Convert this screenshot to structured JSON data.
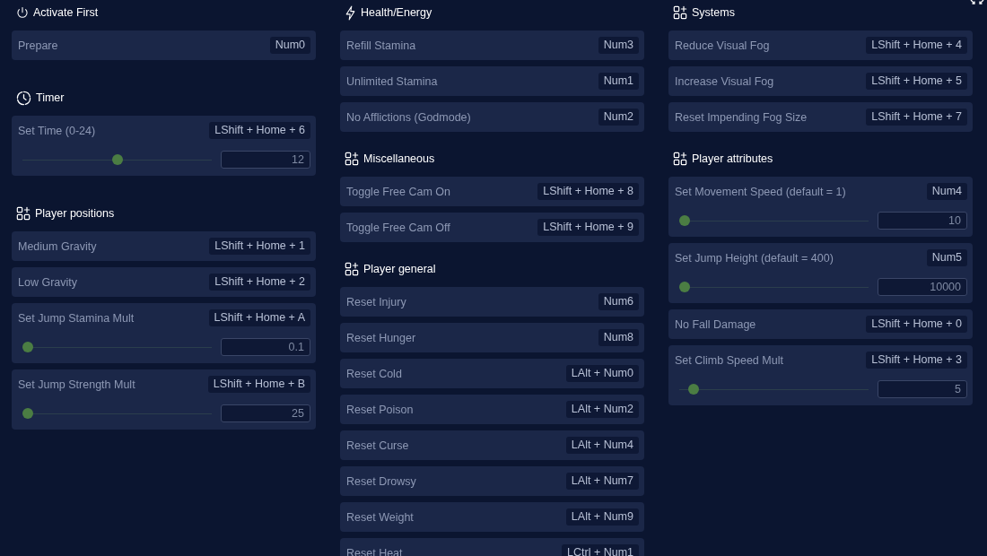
{
  "columns": [
    {
      "sections": [
        {
          "kind": "power",
          "title": "Activate First",
          "items": [
            {
              "kind": "button",
              "label": "Prepare",
              "hotkey": "Num0"
            }
          ]
        },
        {
          "kind": "timer",
          "title": "Timer",
          "items": [
            {
              "kind": "slider",
              "label": "Set Time (0-24)",
              "hotkey": "LShift + Home + 6",
              "level": 0.5,
              "value": "12"
            }
          ]
        },
        {
          "kind": "category",
          "title": "Player positions",
          "items": [
            {
              "kind": "button",
              "label": "Medium Gravity",
              "hotkey": "LShift + Home + 1"
            },
            {
              "kind": "button",
              "label": "Low Gravity",
              "hotkey": "LShift + Home + 2"
            },
            {
              "kind": "slider",
              "label": "Set Jump Stamina Mult",
              "hotkey": "LShift + Home + A",
              "level": 0,
              "value": "0.1"
            },
            {
              "kind": "slider",
              "label": "Set Jump Strength Mult",
              "hotkey": "LShift + Home + B",
              "level": 0,
              "value": "25"
            }
          ]
        }
      ]
    },
    {
      "sections": [
        {
          "kind": "energy",
          "title": "Health/Energy",
          "items": [
            {
              "kind": "button",
              "label": "Refill Stamina",
              "hotkey": "Num3"
            },
            {
              "kind": "button",
              "label": "Unlimited Stamina",
              "hotkey": "Num1"
            },
            {
              "kind": "button",
              "label": "No Afflictions (Godmode)",
              "hotkey": "Num2"
            }
          ]
        },
        {
          "kind": "category",
          "title": "Miscellaneous",
          "items": [
            {
              "kind": "button",
              "label": "Toggle Free Cam On",
              "hotkey": "LShift + Home + 8"
            },
            {
              "kind": "button",
              "label": "Toggle Free Cam Off",
              "hotkey": "LShift + Home + 9"
            }
          ]
        },
        {
          "kind": "category",
          "title": "Player general",
          "items": [
            {
              "kind": "button",
              "label": "Reset Injury",
              "hotkey": "Num6"
            },
            {
              "kind": "button",
              "label": "Reset Hunger",
              "hotkey": "Num8"
            },
            {
              "kind": "button",
              "label": "Reset Cold",
              "hotkey": "LAlt + Num0"
            },
            {
              "kind": "button",
              "label": "Reset Poison",
              "hotkey": "LAlt + Num2"
            },
            {
              "kind": "button",
              "label": "Reset Curse",
              "hotkey": "LAlt + Num4"
            },
            {
              "kind": "button",
              "label": "Reset Drowsy",
              "hotkey": "LAlt + Num7"
            },
            {
              "kind": "button",
              "label": "Reset Weight",
              "hotkey": "LAlt + Num9"
            },
            {
              "kind": "button",
              "label": "Reset Heat",
              "hotkey": "LCtrl + Num1"
            }
          ]
        }
      ]
    },
    {
      "sections": [
        {
          "kind": "category",
          "title": "Systems",
          "items": [
            {
              "kind": "button",
              "label": "Reduce Visual Fog",
              "hotkey": "LShift + Home + 4"
            },
            {
              "kind": "button",
              "label": "Increase Visual Fog",
              "hotkey": "LShift + Home + 5"
            },
            {
              "kind": "button",
              "label": "Reset Impending Fog Size",
              "hotkey": "LShift + Home + 7"
            }
          ]
        },
        {
          "kind": "category",
          "title": "Player attributes",
          "items": [
            {
              "kind": "slider",
              "label": "Set Movement Speed (default = 1)",
              "hotkey": "Num4",
              "level": 0,
              "value": "10"
            },
            {
              "kind": "slider",
              "label": "Set Jump Height (default = 400)",
              "hotkey": "Num5",
              "level": 0,
              "value": "10000"
            },
            {
              "kind": "button",
              "label": "No Fall Damage",
              "hotkey": "LShift + Home + 0"
            },
            {
              "kind": "slider",
              "label": "Set Climb Speed Mult",
              "hotkey": "LShift + Home + 3",
              "level": 0.05,
              "value": "5"
            }
          ]
        }
      ]
    }
  ]
}
